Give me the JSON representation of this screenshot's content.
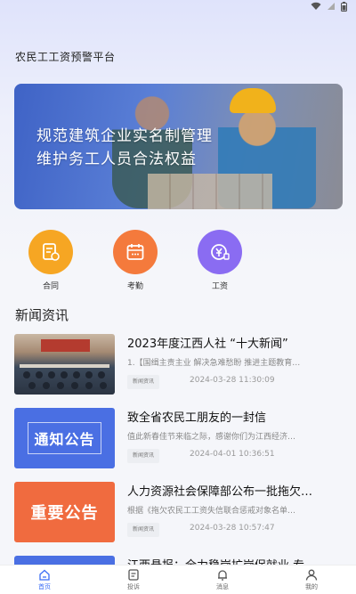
{
  "app": {
    "title": "农民工工资预警平台"
  },
  "banner": {
    "line1": "规范建筑企业实名制管理",
    "line2": "维护务工人员合法权益"
  },
  "quick_actions": [
    {
      "label": "合同",
      "icon": "contract-icon",
      "color": "#f6a623"
    },
    {
      "label": "考勤",
      "icon": "calendar-icon",
      "color": "#f47a3c"
    },
    {
      "label": "工资",
      "icon": "wage-icon",
      "color": "#8a6cf2"
    }
  ],
  "news": {
    "section_title": "新闻资讯",
    "items": [
      {
        "title": "2023年度江西人社 “十大新闻”",
        "desc": "1.【国缉主责主业 解决急难愁盼 推进主题教育…",
        "tag": "新闻资讯",
        "date": "2024-03-28 11:30:09",
        "thumb": "photo"
      },
      {
        "title": "致全省农民工朋友的一封信",
        "desc": "值此新春佳节来临之际，感谢你们为江西经济…",
        "tag": "新闻资讯",
        "date": "2024-04-01 10:36:51",
        "thumb_text": "通知公告",
        "thumb_color": "#4a6fe3"
      },
      {
        "title": "人力资源社会保障部公布一批拖欠…",
        "desc": "根据《拖欠农民工工资失信联合惩戒对象名单…",
        "tag": "新闻资讯",
        "date": "2024-03-28 10:57:47",
        "thumb_text": "重要公告",
        "thumb_color": "#f06b3f"
      },
      {
        "title": "江西悬报：全力稳岗扩岗促就业 专…",
        "desc": "",
        "tag": "",
        "date": "",
        "thumb_color": "#4a6fe3"
      }
    ]
  },
  "tabbar": [
    {
      "label": "首页",
      "icon": "home-icon",
      "active": true
    },
    {
      "label": "投诉",
      "icon": "complaint-icon",
      "active": false
    },
    {
      "label": "消息",
      "icon": "bell-icon",
      "active": false
    },
    {
      "label": "我的",
      "icon": "user-icon",
      "active": false
    }
  ],
  "colors": {
    "accent": "#3b6ef5",
    "background": "#f5f6fa"
  }
}
